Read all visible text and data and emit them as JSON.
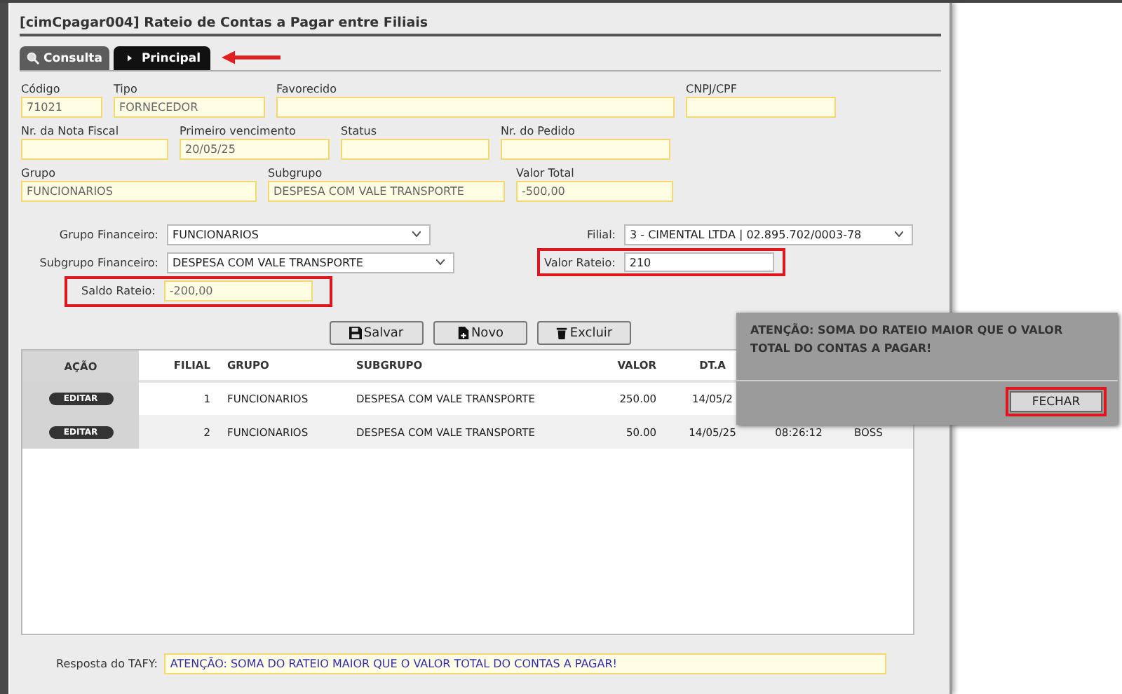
{
  "window": {
    "title": "[cimCpagar004] Rateio de Contas a Pagar entre Filiais"
  },
  "tabs": [
    {
      "label": "Consulta",
      "selected": false,
      "pointed": false
    },
    {
      "label": "Principal",
      "selected": true,
      "pointed": true
    }
  ],
  "fields": [
    [
      {
        "label": "Código",
        "value": "71021"
      },
      {
        "label": "Tipo",
        "value": "FORNECEDOR"
      },
      {
        "label": "Favorecido"
      },
      {
        "label": "CNPJ/CPF"
      }
    ],
    [
      {
        "label": "Nr. da Nota Fiscal"
      },
      {
        "label": "Primeiro vencimento",
        "value": "20/05/25"
      },
      {
        "label": "Status"
      },
      {
        "label": "Nr. do Pedido"
      }
    ],
    [
      {
        "label": "Grupo",
        "value": "FUNCIONARIOS"
      },
      {
        "label": "Subgrupo",
        "value": "DESPESA COM VALE TRANSPORTE"
      },
      {
        "label": "Valor Total",
        "value": "-500,00"
      }
    ]
  ],
  "rateio": {
    "grupo_financeiro": {
      "label": "Grupo Financeiro:",
      "value": "FUNCIONARIOS"
    },
    "subgrupo_financeiro": {
      "label": "Subgrupo Financeiro:",
      "value": "DESPESA COM VALE TRANSPORTE"
    },
    "saldo_rateio": {
      "label": "Saldo Rateio:",
      "value": "-200,00",
      "highlighted": true
    },
    "filial": {
      "label": "Filial:",
      "value": "3 - CIMENTAL LTDA | 02.895.702/0003-78"
    },
    "valor_rateio": {
      "label": "Valor Rateio:",
      "value": "210",
      "highlighted": true
    }
  },
  "buttons": [
    "Salvar",
    "Novo",
    "Excluir"
  ],
  "table": {
    "columns": [
      "AÇÃO",
      "FILIAL",
      "GRUPO",
      "SUBGRUPO",
      "VALOR",
      "DT.A"
    ],
    "rows": [
      {
        "cells": [
          "EDITAR",
          "1",
          "FUNCIONARIOS",
          "DESPESA COM VALE TRANSPORTE",
          "250.00",
          "14/05/2"
        ]
      },
      {
        "cells": [
          "EDITAR",
          "2",
          "FUNCIONARIOS",
          "DESPESA COM VALE TRANSPORTE",
          "50.00",
          "14/05/25",
          "08:26:12",
          "BOSS"
        ]
      }
    ]
  },
  "response": {
    "label": "Resposta do TAFY:",
    "value": "ATENÇÃO: SOMA DO RATEIO MAIOR QUE O VALOR TOTAL DO CONTAS A PAGAR!"
  },
  "dialog": {
    "message": "ATENÇÃO: SOMA DO RATEIO MAIOR QUE O VALOR TOTAL DO CONTAS A PAGAR!",
    "button": "FECHAR",
    "button_highlighted": true
  }
}
